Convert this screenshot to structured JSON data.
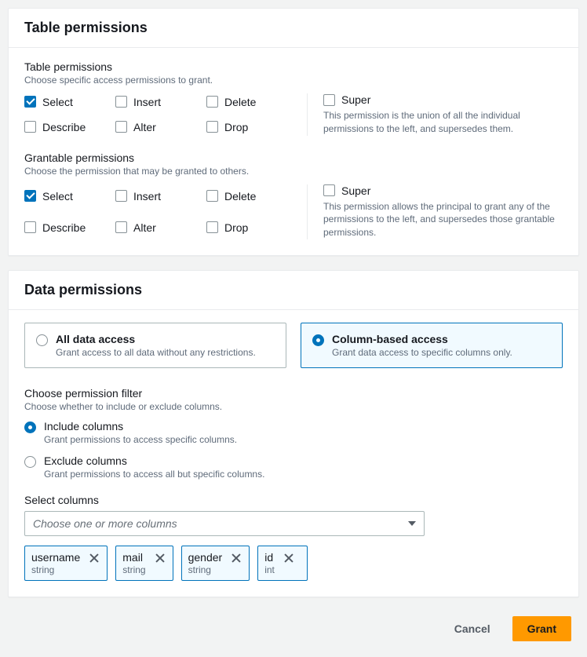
{
  "table_panel": {
    "title": "Table permissions",
    "table_perms": {
      "title": "Table permissions",
      "hint": "Choose specific access permissions to grant.",
      "items": [
        {
          "label": "Select",
          "checked": true
        },
        {
          "label": "Insert",
          "checked": false
        },
        {
          "label": "Delete",
          "checked": false
        },
        {
          "label": "Describe",
          "checked": false
        },
        {
          "label": "Alter",
          "checked": false
        },
        {
          "label": "Drop",
          "checked": false
        }
      ],
      "super": {
        "label": "Super",
        "checked": false,
        "desc": "This permission is the union of all the individual permissions to the left, and supersedes them."
      }
    },
    "grantable_perms": {
      "title": "Grantable permissions",
      "hint": "Choose the permission that may be granted to others.",
      "items": [
        {
          "label": "Select",
          "checked": true
        },
        {
          "label": "Insert",
          "checked": false
        },
        {
          "label": "Delete",
          "checked": false
        },
        {
          "label": "Describe",
          "checked": false
        },
        {
          "label": "Alter",
          "checked": false
        },
        {
          "label": "Drop",
          "checked": false
        }
      ],
      "super": {
        "label": "Super",
        "checked": false,
        "desc": "This permission allows the principal to grant any of the permissions to the left, and supersedes those grantable permissions."
      }
    }
  },
  "data_panel": {
    "title": "Data permissions",
    "access": {
      "all": {
        "title": "All data access",
        "desc": "Grant access to all data without any restrictions.",
        "selected": false
      },
      "col": {
        "title": "Column-based access",
        "desc": "Grant data access to specific columns only.",
        "selected": true
      }
    },
    "filter": {
      "title": "Choose permission filter",
      "hint": "Choose whether to include or exclude columns.",
      "include": {
        "title": "Include columns",
        "desc": "Grant permissions to access specific columns.",
        "selected": true
      },
      "exclude": {
        "title": "Exclude columns",
        "desc": "Grant permissions to access all but specific columns.",
        "selected": false
      }
    },
    "select_columns": {
      "label": "Select columns",
      "placeholder": "Choose one or more columns",
      "tokens": [
        {
          "name": "username",
          "type": "string"
        },
        {
          "name": "mail",
          "type": "string"
        },
        {
          "name": "gender",
          "type": "string"
        },
        {
          "name": "id",
          "type": "int"
        }
      ]
    }
  },
  "footer": {
    "cancel": "Cancel",
    "grant": "Grant"
  }
}
